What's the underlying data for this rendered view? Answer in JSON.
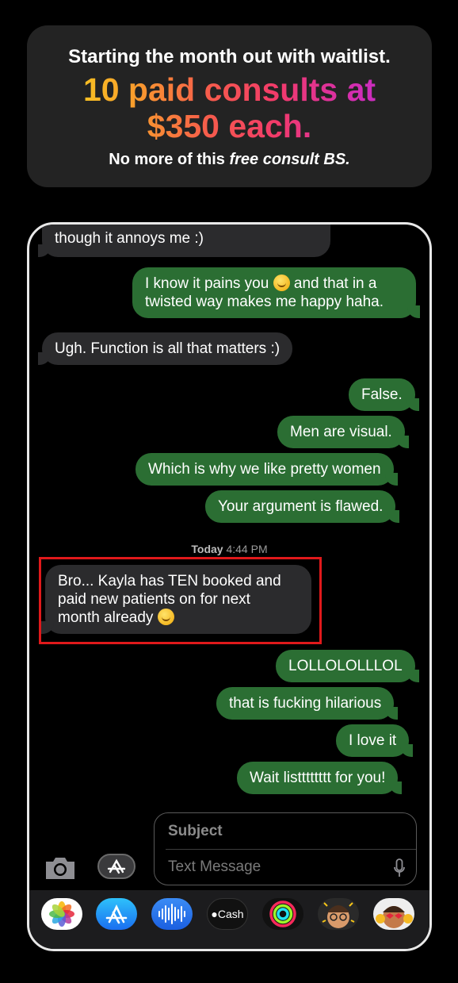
{
  "header": {
    "line1": "Starting the month out with waitlist.",
    "headline_1": "10 paid consults at",
    "headline_2": "$350 each.",
    "line3_prefix": "No more of this ",
    "line3_italic": "free consult BS."
  },
  "conversation": {
    "messages": [
      {
        "from": "them",
        "text": "though it annoys me :)"
      },
      {
        "from": "me",
        "line1": "I know it pains you",
        "line1_after": " and that in a",
        "line2": "twisted way makes me happy haha."
      },
      {
        "from": "them",
        "text": "Ugh. Function is all that matters :)"
      },
      {
        "from": "me",
        "text": "False."
      },
      {
        "from": "me",
        "text": "Men are visual."
      },
      {
        "from": "me",
        "text": "Which is why we like pretty women"
      },
      {
        "from": "me",
        "text": "Your argument is flawed."
      },
      {
        "from": "them",
        "line1": "Bro... Kayla has TEN booked and",
        "line2": "paid new patients on for next",
        "line3": "month already"
      },
      {
        "from": "me",
        "text": "LOLLOLOLLLOL"
      },
      {
        "from": "me",
        "text": "that is fucking hilarious"
      },
      {
        "from": "me",
        "text": "I love it"
      },
      {
        "from": "me",
        "text": "Wait listttttttt for you!"
      }
    ],
    "timestamp_day": "Today",
    "timestamp_time": "4:44 PM"
  },
  "composer": {
    "subject_placeholder": "Subject",
    "message_placeholder": "Text Message"
  },
  "dock": {
    "apps": [
      "photos-icon",
      "app-store-icon",
      "voice-memo-icon",
      "apple-cash-icon",
      "activity-icon",
      "memoji-icon",
      "memoji-sticker-icon"
    ],
    "cash_label": "Cash"
  },
  "colors": {
    "sent_bubble": "#2b6e33",
    "received_bubble": "#2b2b2d",
    "highlight_box": "#e0191b"
  }
}
